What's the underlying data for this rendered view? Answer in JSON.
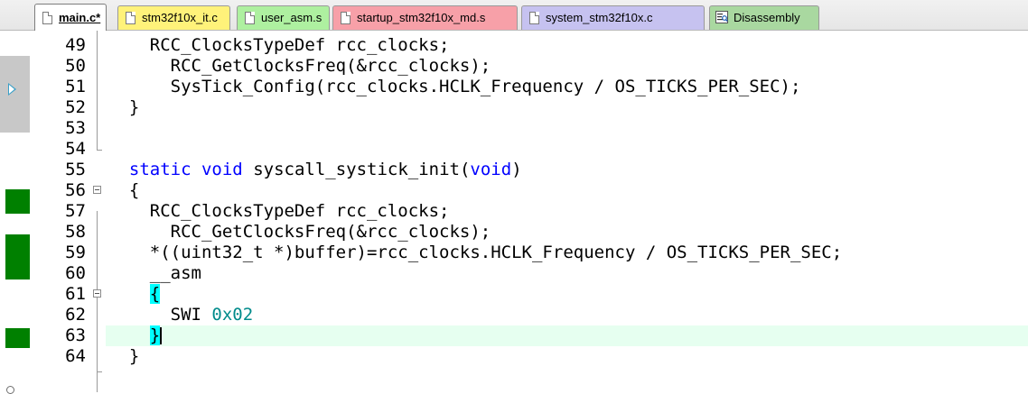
{
  "tabs": [
    {
      "label": "main.c*",
      "color": "#ffffff",
      "active": true
    },
    {
      "label": "stm32f10x_it.c",
      "color": "#fff27a"
    },
    {
      "label": "user_asm.s",
      "color": "#aef0a0"
    },
    {
      "label": "startup_stm32f10x_md.s",
      "color": "#f7a0a8"
    },
    {
      "label": "system_stm32f10x.c",
      "color": "#c6c2f0"
    },
    {
      "label": "Disassembly",
      "color": "#a9d8a0"
    }
  ],
  "editor": {
    "current_line": "63",
    "lines": [
      {
        "num": "49",
        "text": "    RCC_ClocksTypeDef rcc_clocks;"
      },
      {
        "num": "50",
        "text": "      RCC_GetClocksFreq(&rcc_clocks);"
      },
      {
        "num": "51",
        "text": "      SysTick_Config(rcc_clocks.HCLK_Frequency / OS_TICKS_PER_SEC);"
      },
      {
        "num": "52",
        "text": "  }"
      },
      {
        "num": "53",
        "text": ""
      },
      {
        "num": "54",
        "text": ""
      },
      {
        "num": "55",
        "kw1": "static",
        "kw2": "void",
        "mid": " syscall_systick_init(",
        "kw3": "void",
        "end": ")"
      },
      {
        "num": "56",
        "text": "  {"
      },
      {
        "num": "57",
        "text": "    RCC_ClocksTypeDef rcc_clocks;"
      },
      {
        "num": "58",
        "text": "      RCC_GetClocksFreq(&rcc_clocks);"
      },
      {
        "num": "59",
        "text": "    *((uint32_t *)buffer)=rcc_clocks.HCLK_Frequency / OS_TICKS_PER_SEC;"
      },
      {
        "num": "60",
        "text": "    __asm"
      },
      {
        "num": "61",
        "brace": "{"
      },
      {
        "num": "62",
        "instr": "SWI",
        "operand": "0x02"
      },
      {
        "num": "63",
        "brace": "}"
      },
      {
        "num": "64",
        "text": "  }"
      }
    ]
  }
}
